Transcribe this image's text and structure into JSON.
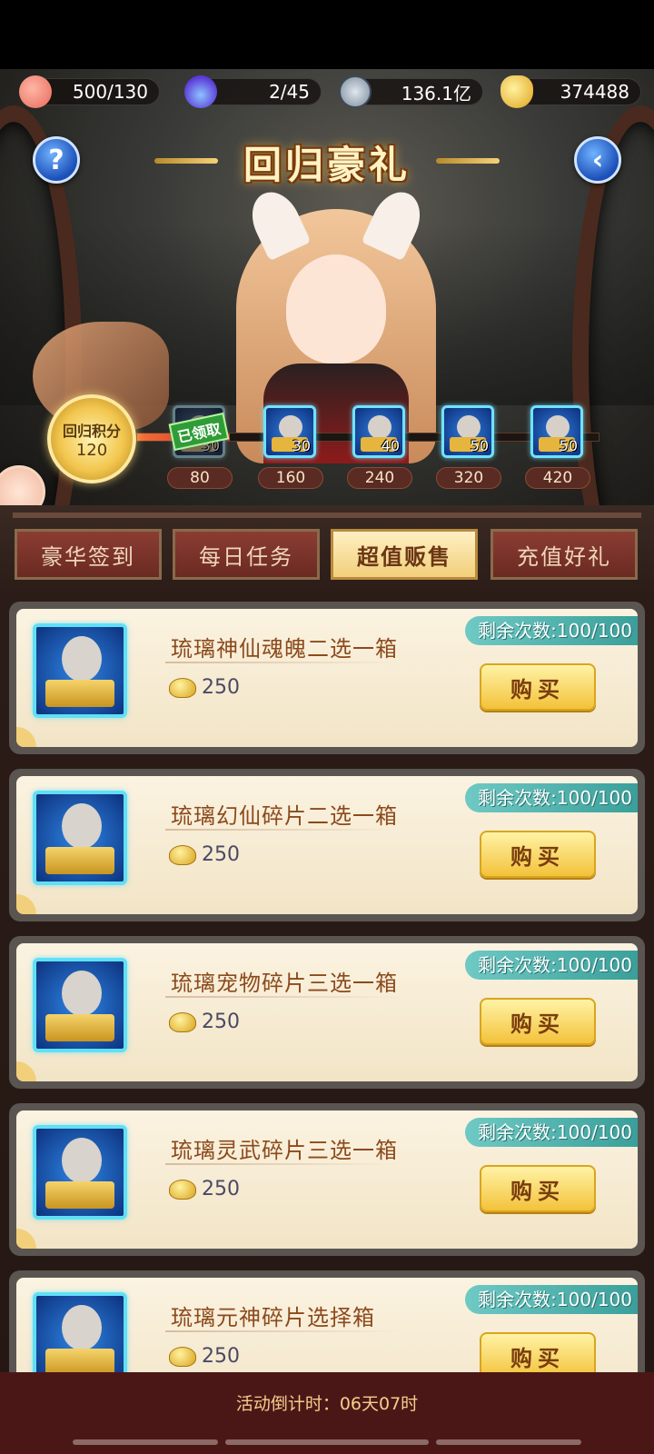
{
  "resources": {
    "peach": "500/130",
    "flame": "2/45",
    "coin": "136.1亿",
    "gold": "374488"
  },
  "banner": {
    "title": "回归豪礼"
  },
  "points": {
    "label": "回归积分",
    "value": "120",
    "progress_fraction": 0.2
  },
  "milestones": [
    {
      "threshold": "80",
      "count": "30",
      "claimed": true
    },
    {
      "threshold": "160",
      "count": "30",
      "claimed": false
    },
    {
      "threshold": "240",
      "count": "40",
      "claimed": false
    },
    {
      "threshold": "320",
      "count": "50",
      "claimed": false
    },
    {
      "threshold": "420",
      "count": "50",
      "claimed": false
    }
  ],
  "claimed_label": "已领取",
  "tabs": [
    {
      "label": "豪华签到",
      "active": false
    },
    {
      "label": "每日任务",
      "active": false
    },
    {
      "label": "超值贩售",
      "active": true
    },
    {
      "label": "充值好礼",
      "active": false
    }
  ],
  "items": [
    {
      "name": "琉璃神仙魂魄二选一箱",
      "price": "250",
      "remaining": "剩余次数:100/100",
      "buy_label": "购买"
    },
    {
      "name": "琉璃幻仙碎片二选一箱",
      "price": "250",
      "remaining": "剩余次数:100/100",
      "buy_label": "购买"
    },
    {
      "name": "琉璃宠物碎片三选一箱",
      "price": "250",
      "remaining": "剩余次数:100/100",
      "buy_label": "购买"
    },
    {
      "name": "琉璃灵武碎片三选一箱",
      "price": "250",
      "remaining": "剩余次数:100/100",
      "buy_label": "购买"
    },
    {
      "name": "琉璃元神碎片选择箱",
      "price": "250",
      "remaining": "剩余次数:100/100",
      "buy_label": "购买"
    }
  ],
  "countdown": "活动倒计时：06天07时",
  "colors": {
    "accent_gold": "#f3c23a",
    "tab_active": "#f2cf7a",
    "badge_teal": "#3a9f9a",
    "reward_border": "#6fe3ff"
  }
}
